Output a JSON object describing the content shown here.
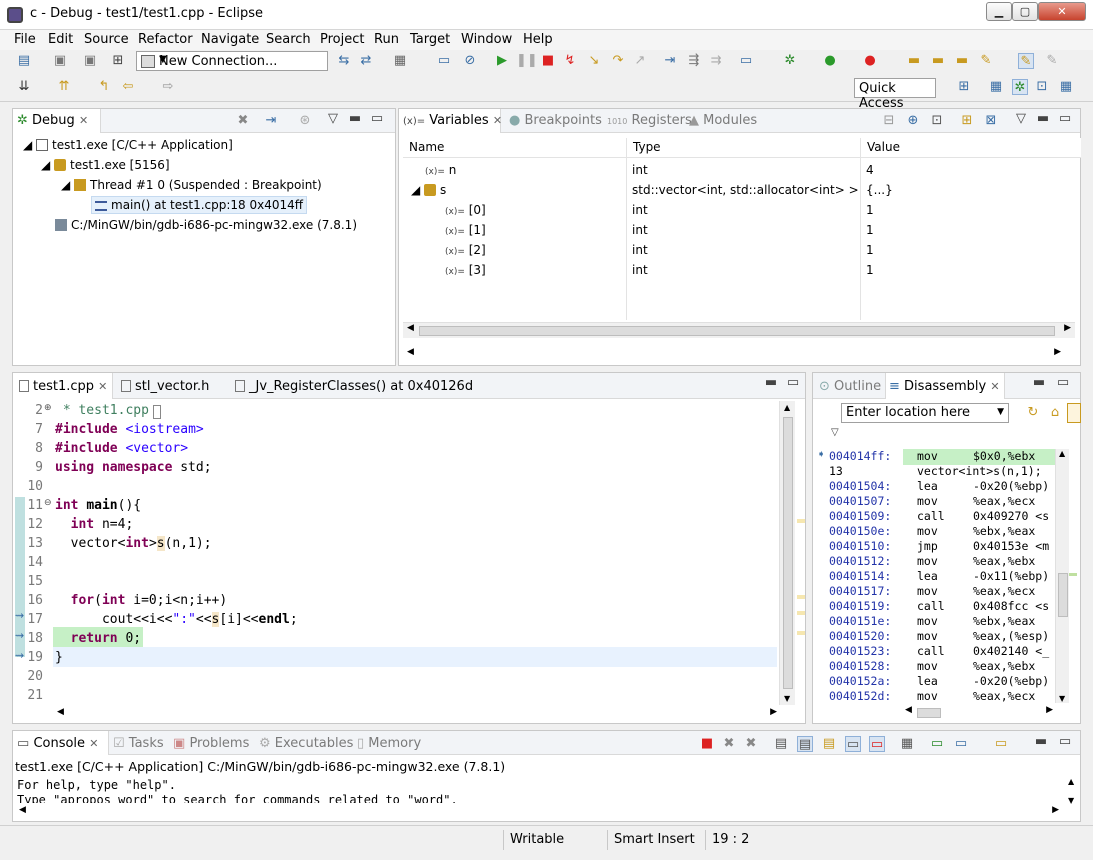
{
  "window": {
    "title": "c - Debug - test1/test1.cpp - Eclipse",
    "minimize": "▁",
    "maximize": "▢",
    "close": "✕"
  },
  "menu": [
    "File",
    "Edit",
    "Source",
    "Refactor",
    "Navigate",
    "Search",
    "Project",
    "Run",
    "Target",
    "Window",
    "Help"
  ],
  "toolbar": {
    "connection": "New Connection...",
    "quick_access": "Quick Access"
  },
  "debug_view": {
    "tab": "Debug",
    "items": [
      {
        "label": "test1.exe [C/C++ Application]",
        "icon": "c-app-icon"
      },
      {
        "label": "test1.exe [5156]",
        "icon": "process-icon"
      },
      {
        "label": "Thread #1 0 (Suspended : Breakpoint)",
        "icon": "thread-icon"
      },
      {
        "label": "main() at test1.cpp:18 0x4014ff",
        "icon": "stack-frame-icon"
      },
      {
        "label": "C:/MinGW/bin/gdb-i686-pc-mingw32.exe (7.8.1)",
        "icon": "gdb-icon"
      }
    ]
  },
  "variables_view": {
    "tabs": [
      "Variables",
      "Breakpoints",
      "Registers",
      "Modules"
    ],
    "columns": [
      "Name",
      "Type",
      "Value"
    ],
    "rows": [
      {
        "name": "n",
        "type": "int",
        "value": "4",
        "indent": 0
      },
      {
        "name": "s",
        "type": "std::vector<int, std::allocator<int> >",
        "value": "{...}",
        "indent": 0
      },
      {
        "name": "[0]",
        "type": "int",
        "value": "1",
        "indent": 1
      },
      {
        "name": "[1]",
        "type": "int",
        "value": "1",
        "indent": 1
      },
      {
        "name": "[2]",
        "type": "int",
        "value": "1",
        "indent": 1
      },
      {
        "name": "[3]",
        "type": "int",
        "value": "1",
        "indent": 1
      }
    ],
    "var_prefix": "(x)="
  },
  "editor": {
    "tabs": [
      "test1.cpp",
      "stl_vector.h",
      "_Jv_RegisterClasses() at 0x40126d"
    ],
    "lines": [
      {
        "num": "2",
        "text": " * test1.cpp"
      },
      {
        "num": "7",
        "text": "#include <iostream>"
      },
      {
        "num": "8",
        "text": "#include <vector>"
      },
      {
        "num": "9",
        "text": "using namespace std;"
      },
      {
        "num": "10",
        "text": ""
      },
      {
        "num": "11",
        "text": "int main(){"
      },
      {
        "num": "12",
        "text": "  int n=4;"
      },
      {
        "num": "13",
        "text": "  vector<int>s(n,1);"
      },
      {
        "num": "14",
        "text": ""
      },
      {
        "num": "15",
        "text": ""
      },
      {
        "num": "16",
        "text": "  for(int i=0;i<n;i++)"
      },
      {
        "num": "17",
        "text": "      cout<<i<<\":\"<<s[i]<<endl;"
      },
      {
        "num": "18",
        "text": "  return 0;"
      },
      {
        "num": "19",
        "text": "}"
      },
      {
        "num": "20",
        "text": ""
      },
      {
        "num": "21",
        "text": ""
      }
    ]
  },
  "disassembly_view": {
    "tabs": [
      "Outline",
      "Disassembly"
    ],
    "location_placeholder": "Enter location here",
    "lines": [
      {
        "addr": "004014ff:",
        "op": "mov",
        "args": "$0x0,%ebx"
      },
      {
        "addr": "13",
        "op": "vector<int>s(n,1);",
        "args": ""
      },
      {
        "addr": "00401504:",
        "op": "lea",
        "args": "-0x20(%ebp)"
      },
      {
        "addr": "00401507:",
        "op": "mov",
        "args": "%eax,%ecx"
      },
      {
        "addr": "00401509:",
        "op": "call",
        "args": "0x409270 <s"
      },
      {
        "addr": "0040150e:",
        "op": "mov",
        "args": "%ebx,%eax"
      },
      {
        "addr": "00401510:",
        "op": "jmp",
        "args": "0x40153e <m"
      },
      {
        "addr": "00401512:",
        "op": "mov",
        "args": "%eax,%ebx"
      },
      {
        "addr": "00401514:",
        "op": "lea",
        "args": "-0x11(%ebp)"
      },
      {
        "addr": "00401517:",
        "op": "mov",
        "args": "%eax,%ecx"
      },
      {
        "addr": "00401519:",
        "op": "call",
        "args": "0x408fcc <s"
      },
      {
        "addr": "0040151e:",
        "op": "mov",
        "args": "%ebx,%eax"
      },
      {
        "addr": "00401520:",
        "op": "mov",
        "args": "%eax,(%esp)"
      },
      {
        "addr": "00401523:",
        "op": "call",
        "args": "0x402140 <_"
      },
      {
        "addr": "00401528:",
        "op": "mov",
        "args": "%eax,%ebx"
      },
      {
        "addr": "0040152a:",
        "op": "lea",
        "args": "-0x20(%ebp)"
      },
      {
        "addr": "0040152d:",
        "op": "mov",
        "args": "%eax,%ecx"
      }
    ]
  },
  "console_view": {
    "tabs": [
      "Console",
      "Tasks",
      "Problems",
      "Executables",
      "Memory"
    ],
    "process": "test1.exe [C/C++ Application] C:/MinGW/bin/gdb-i686-pc-mingw32.exe (7.8.1)",
    "lines": [
      "For help, type \"help\".",
      "Type \"apropos word\" to search for commands related to \"word\"."
    ]
  },
  "status": {
    "writable": "Writable",
    "insert": "Smart Insert",
    "position": "19 : 2"
  },
  "colors": {
    "current_line": "#c6f0c6",
    "keyword": "#7f0055",
    "string": "#2a00ff",
    "comment": "#3f7f5f",
    "highlight": "#e8f2fe"
  }
}
